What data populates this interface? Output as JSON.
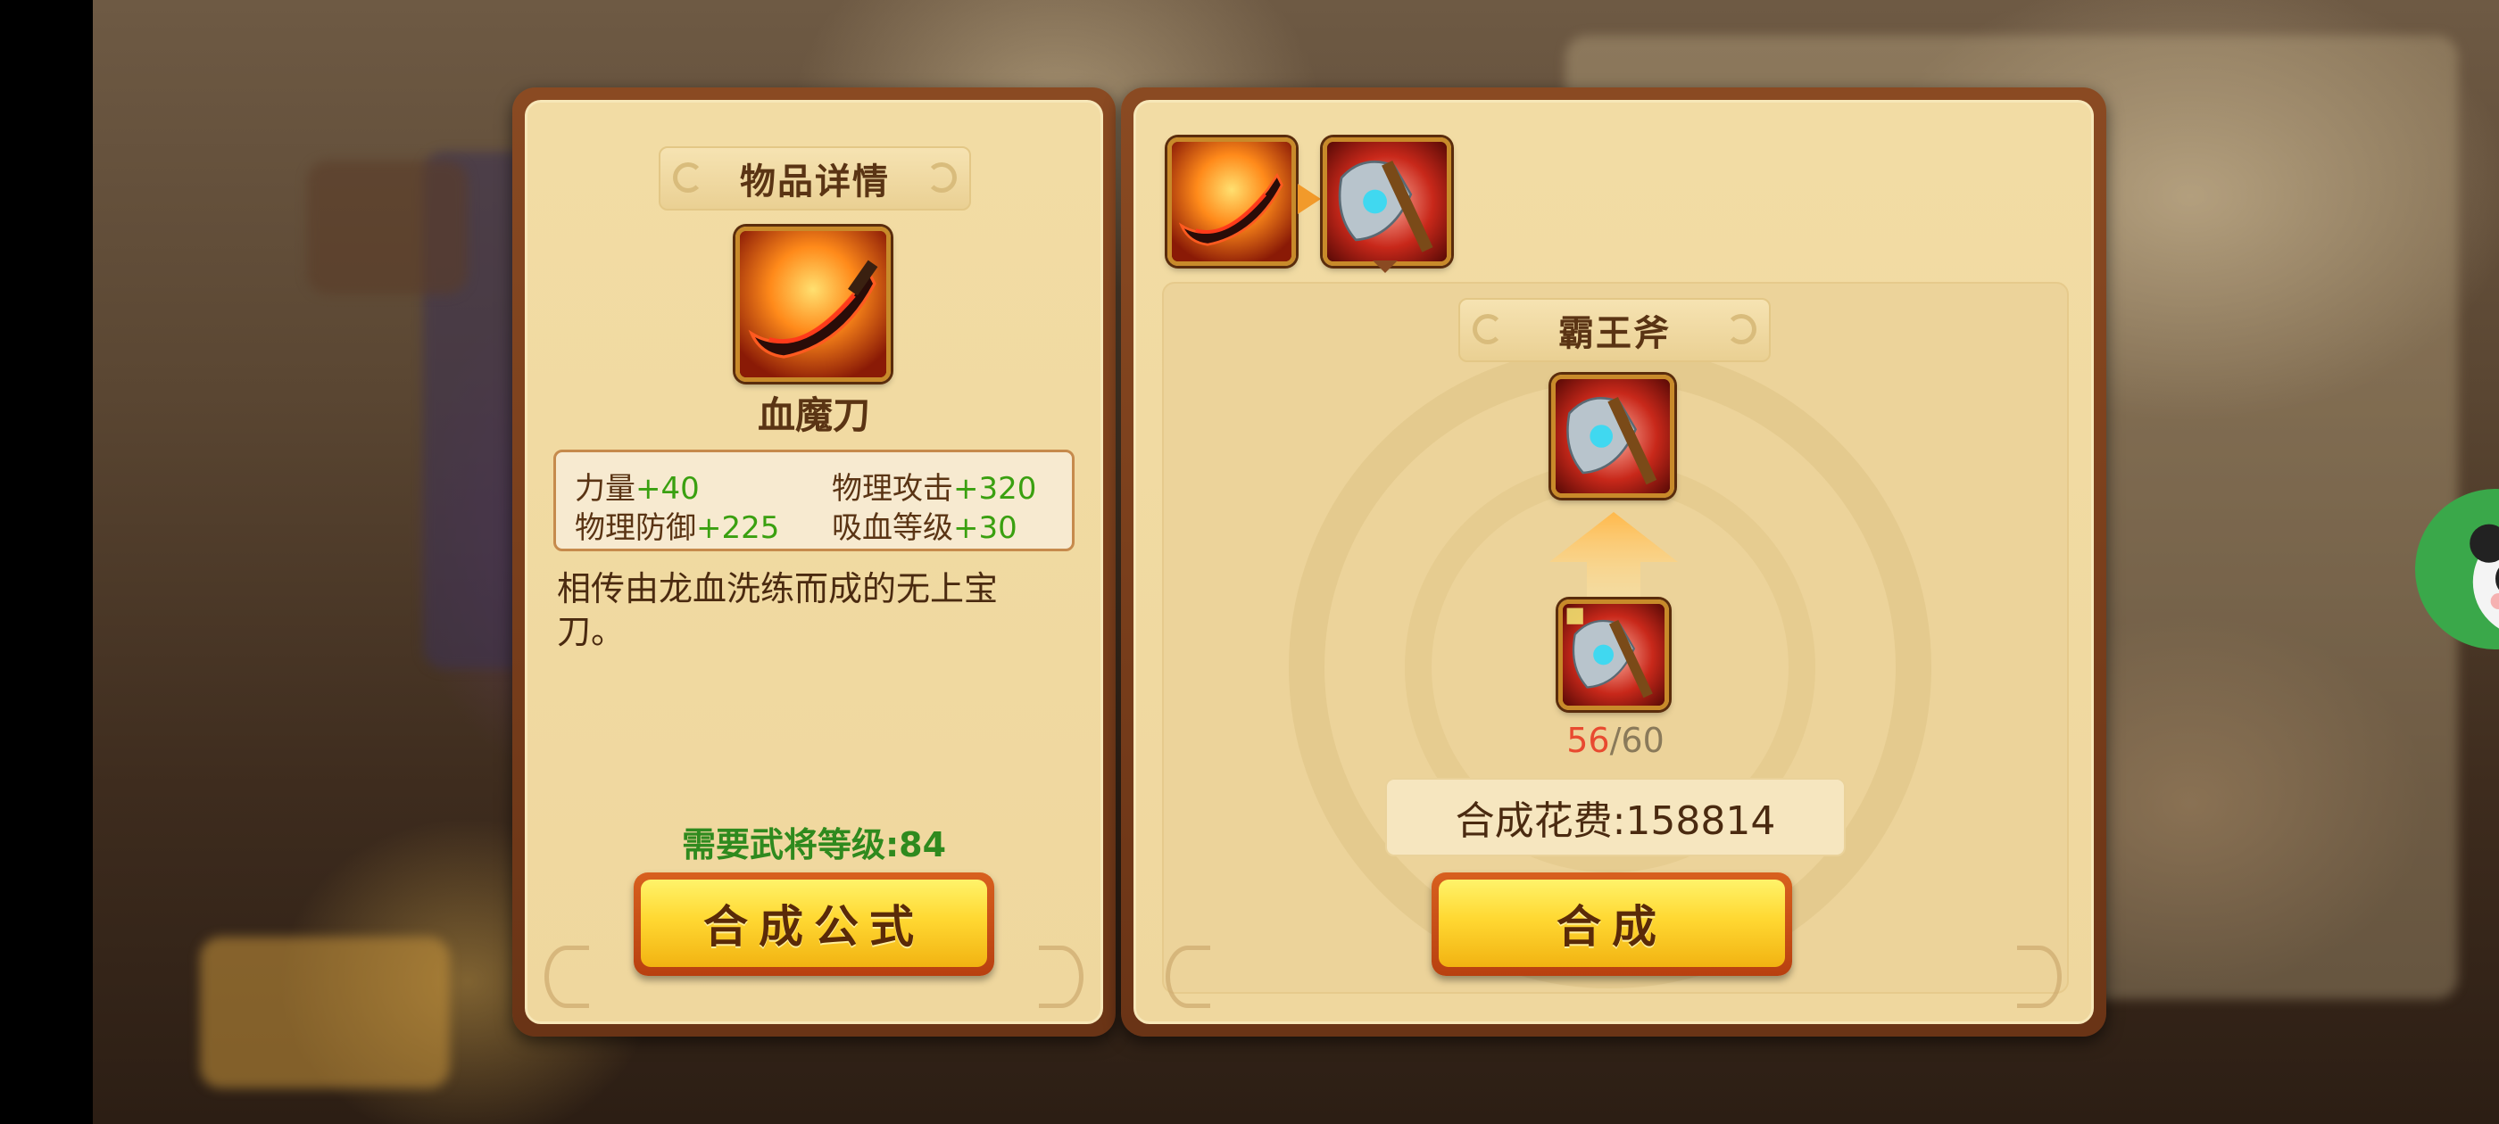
{
  "left_panel": {
    "title": "物品详情",
    "item_name": "血魔刀",
    "stats": [
      {
        "label": "力量",
        "value": "+40"
      },
      {
        "label": "物理攻击",
        "value": "+320"
      },
      {
        "label": "物理防御",
        "value": "+225"
      },
      {
        "label": "吸血等级",
        "value": "+30"
      }
    ],
    "description": "相传由龙血洗练而成的无上宝刀。",
    "requirement": "需要武将等级:84",
    "formula_button": "合成公式"
  },
  "right_panel": {
    "target_title": "霸王斧",
    "owned_count": "56",
    "count_separator": "/",
    "required_count": "60",
    "cost_text": "合成花费:158814",
    "craft_button": "合成"
  },
  "icons": {
    "source_item": "blood-demon-blade-icon",
    "target_item": "overlord-axe-icon",
    "material_item": "overlord-axe-fragment-icon",
    "upgrade_arrow": "up-arrow-icon",
    "avatar": "panda-avatar-icon"
  },
  "colors": {
    "stat_value": "#3aa010",
    "requirement": "#2f8a1e",
    "owned_count": "#e84a30",
    "button_gold": "#ffd832"
  }
}
